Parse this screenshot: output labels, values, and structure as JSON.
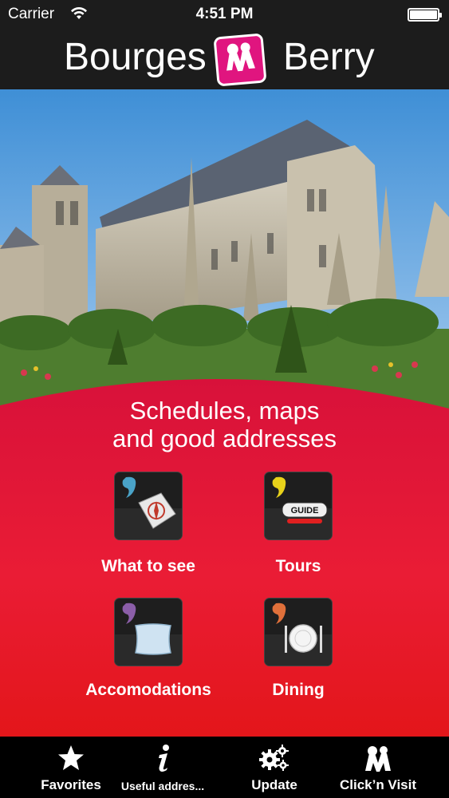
{
  "status_bar": {
    "carrier": "Carrier",
    "time": "4:51 PM"
  },
  "header": {
    "title_left": "Bourges",
    "title_right": "Berry"
  },
  "tagline": {
    "line1": "Schedules, maps",
    "line2": "and good addresses"
  },
  "tiles": [
    {
      "label": "What to see",
      "icon": "compass-icon",
      "color": "#4aa3c8"
    },
    {
      "label": "Tours",
      "icon": "guide-icon",
      "color": "#e8d21a"
    },
    {
      "label": "Accomodations",
      "icon": "pillow-icon",
      "color": "#8b5ea8"
    },
    {
      "label": "Dining",
      "icon": "plate-icon",
      "color": "#e0703a"
    }
  ],
  "tab_bar": {
    "favorites": "Favorites",
    "useful": "Useful addres...",
    "update": "Update",
    "clicknvisit": "Click’n Visit"
  },
  "colors": {
    "accent": "#e8102e",
    "header": "#1c1c1c",
    "logo": "#e0157f"
  }
}
